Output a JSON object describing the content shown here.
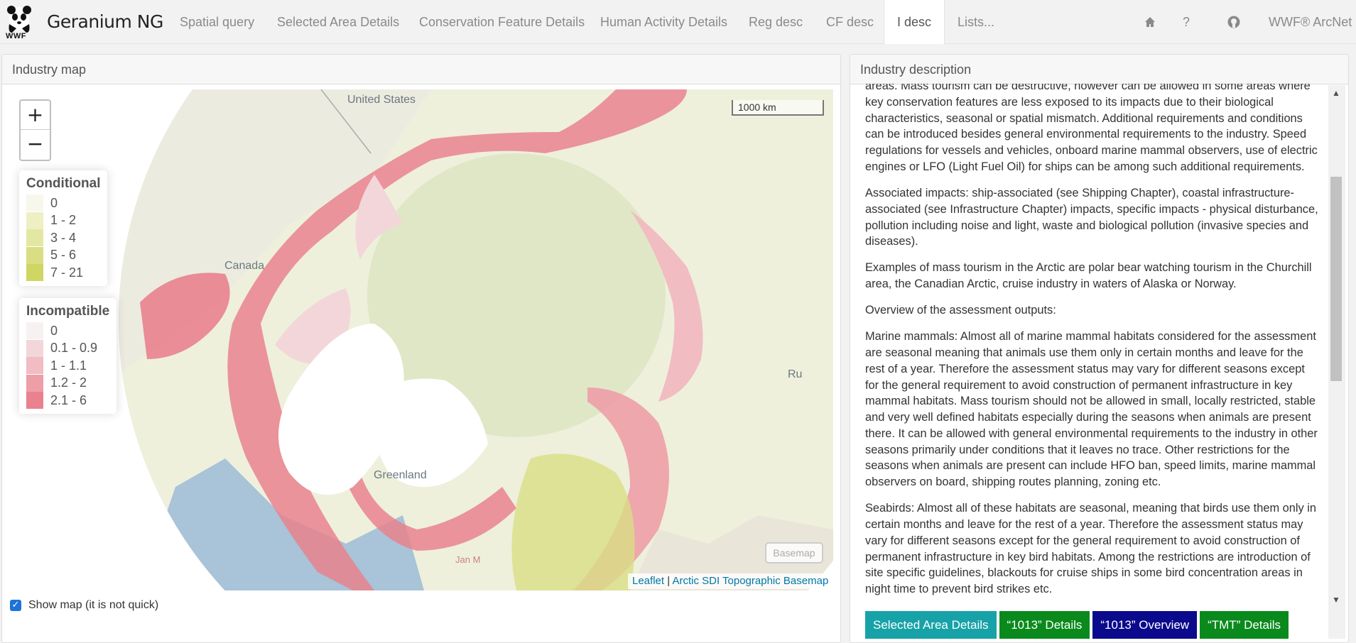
{
  "app": {
    "brand": "Geranium NG",
    "logo_text": "WWF"
  },
  "nav": {
    "tabs": [
      {
        "label": "Spatial query"
      },
      {
        "label": "Selected Area Details"
      },
      {
        "label": "Conservation Feature Details"
      },
      {
        "label": "Human Activity Details"
      },
      {
        "label": "Reg desc"
      },
      {
        "label": "CF desc"
      },
      {
        "label": "I desc",
        "active": true
      },
      {
        "label": "Lists..."
      }
    ],
    "right": {
      "home_icon": "home-icon",
      "help_label": "?",
      "github_icon": "github-icon",
      "org_label": "WWF® ArcNet"
    }
  },
  "left_panel": {
    "title": "Industry map",
    "zoom_in": "+",
    "zoom_out": "−",
    "scale_label": "1000 km",
    "basemap_button": "Basemap",
    "attribution": {
      "leaflet": "Leaflet",
      "separator": " | ",
      "basemap": "Arctic SDI Topographic Basemap"
    },
    "map_labels": {
      "us": "United States",
      "canada": "Canada",
      "greenland": "Greenland",
      "ru": "Ru",
      "jan": "Jan M"
    },
    "legend_conditional": {
      "title": "Conditional",
      "items": [
        {
          "label": "0",
          "color": "#f7f7ec"
        },
        {
          "label": "1 - 2",
          "color": "#eef0c4"
        },
        {
          "label": "3 - 4",
          "color": "#e3e7a4"
        },
        {
          "label": "5 - 6",
          "color": "#d9de84"
        },
        {
          "label": "7 - 21",
          "color": "#cfd664"
        }
      ]
    },
    "legend_incompatible": {
      "title": "Incompatible",
      "items": [
        {
          "label": "0",
          "color": "#f7f1f2"
        },
        {
          "label": "0.1 - 0.9",
          "color": "#f3d6da"
        },
        {
          "label": "1 - 1.1",
          "color": "#f1bcc2"
        },
        {
          "label": "1.2 - 2",
          "color": "#ed9ea7"
        },
        {
          "label": "2.1 - 6",
          "color": "#e9828e"
        }
      ]
    },
    "show_map_label": "Show map (it is not quick)",
    "show_map_checked": true
  },
  "right_panel": {
    "title": "Industry description",
    "paragraphs": [
      "areas. Mass tourism can be destructive, however can be allowed in some areas where key conservation features are less exposed to its impacts due to their biological characteristics, seasonal or spatial mismatch. Additional requirements and conditions can be introduced besides general environmental requirements to the industry. Speed regulations for vessels and vehicles, onboard marine mammal observers, use of electric engines or LFO (Light Fuel Oil) for ships can be among such additional requirements.",
      "Associated impacts: ship-associated (see Shipping Chapter), coastal infrastructure-associated (see Infrastructure Chapter) impacts, specific impacts - physical disturbance, pollution including noise and light, waste and biological pollution (invasive species and diseases).",
      "Examples of mass tourism in the Arctic are polar bear watching tourism in the Churchill area, the Canadian Arctic, cruise industry in waters of Alaska or Norway.",
      "Overview of the assessment outputs:",
      "Marine mammals: Almost all of marine mammal habitats considered for the assessment are seasonal meaning that animals use them only in certain months and leave for the rest of a year. Therefore the assessment status may vary for different seasons except for the general requirement to avoid construction of permanent infrastructure in key mammal habitats. Mass tourism should not be allowed in small, locally restricted, stable and very well defined habitats especially during the seasons when animals are present there. It can be allowed with general environmental requirements to the industry in other seasons primarily under conditions that it leaves no trace. Other restrictions for the seasons when animals are present can include HFO ban, speed limits, marine mammal observers on board, shipping routes planning, zoning etc.",
      "Seabirds: Almost all of these habitats are seasonal, meaning that birds use them only in certain months and leave for the rest of a year. Therefore the assessment status may vary for different seasons except for the general requirement to avoid construction of permanent infrastructure in key bird habitats. Among the restrictions are introduction of site specific guidelines, blackouts for cruise ships in some bird concentration areas in night time to prevent bird strikes etc."
    ],
    "buttons": [
      {
        "label": "Selected Area Details",
        "color": "#17a2a8"
      },
      {
        "label": "“1013” Details",
        "color": "#0a8a1c"
      },
      {
        "label": "“1013” Overview",
        "color": "#0b0a8c"
      },
      {
        "label": "“TMT” Details",
        "color": "#0a8a1c"
      }
    ]
  }
}
